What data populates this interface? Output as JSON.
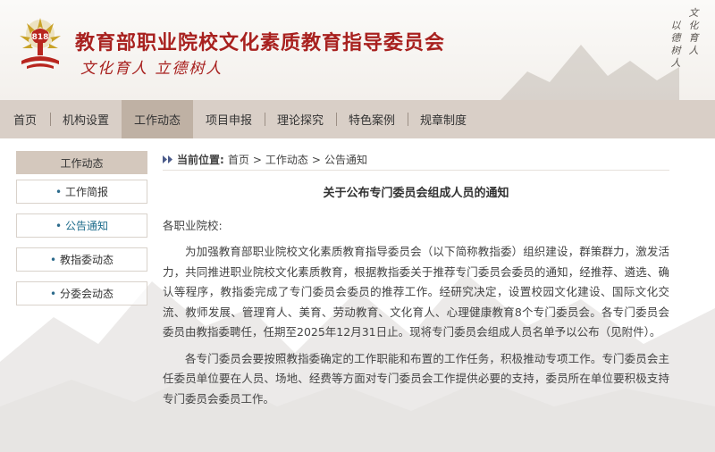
{
  "header": {
    "site_title": "教育部职业院校文化素质教育指导委员会",
    "slogan": "文化育人 立德树人",
    "calligraphy_line_1": "文化育人",
    "calligraphy_line_2": "以德树人",
    "logo_icon": "tree-logo-icon",
    "colors": {
      "title": "#a8211f",
      "nav_bg": "#d9cfc7",
      "nav_active": "#bfb1a4"
    }
  },
  "nav": {
    "items": [
      {
        "label": "首页"
      },
      {
        "label": "机构设置"
      },
      {
        "label": "工作动态"
      },
      {
        "label": "项目申报"
      },
      {
        "label": "理论探究"
      },
      {
        "label": "特色案例"
      },
      {
        "label": "规章制度"
      }
    ],
    "active_index": 2
  },
  "sidebar": {
    "title": "工作动态",
    "items": [
      {
        "label": "工作简报"
      },
      {
        "label": "公告通知"
      },
      {
        "label": "教指委动态"
      },
      {
        "label": "分委会动态"
      }
    ],
    "active_index": 1
  },
  "breadcrumb": {
    "label": "当前位置:",
    "items": [
      "首页",
      "工作动态",
      "公告通知"
    ],
    "separator": ">"
  },
  "article": {
    "title": "关于公布专门委员会组成人员的通知",
    "salutation": "各职业院校:",
    "paragraphs": [
      "为加强教育部职业院校文化素质教育指导委员会（以下简称教指委）组织建设，群策群力，激发活力，共同推进职业院校文化素质教育，根据教指委关于推荐专门委员会委员的通知，经推荐、遴选、确认等程序，教指委完成了专门委员会委员的推荐工作。经研究决定，设置校园文化建设、国际文化交流、教师发展、管理育人、美育、劳动教育、文化育人、心理健康教育8个专门委员会。各专门委员会委员由教指委聘任，任期至2025年12月31日止。现将专门委员会组成人员名单予以公布（见附件）。",
      "各专门委员会要按照教指委确定的工作职能和布置的工作任务，积极推动专项工作。专门委员会主任委员单位要在人员、场地、经费等方面对专门委员会工作提供必要的支持，委员所在单位要积极支持专门委员会委员工作。"
    ]
  }
}
